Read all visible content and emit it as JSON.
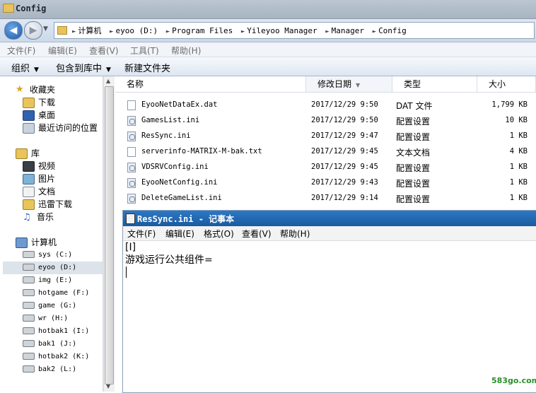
{
  "window": {
    "title": "Config"
  },
  "address": {
    "crumbs": [
      "计算机",
      "eyoo (D:)",
      "Program Files",
      "Yileyoo Manager",
      "Manager",
      "Config"
    ]
  },
  "menubar": [
    "文件(F)",
    "编辑(E)",
    "查看(V)",
    "工具(T)",
    "帮助(H)"
  ],
  "toolbar": {
    "organize": "组织",
    "include": "包含到库中",
    "newfolder": "新建文件夹"
  },
  "nav": {
    "favorites": {
      "label": "收藏夹",
      "items": [
        "下载",
        "桌面",
        "最近访问的位置"
      ]
    },
    "libraries": {
      "label": "库",
      "items": [
        "视频",
        "图片",
        "文档",
        "迅雷下载",
        "音乐"
      ]
    },
    "computer": {
      "label": "计算机",
      "drives": [
        "sys (C:)",
        "eyoo (D:)",
        "img (E:)",
        "hotgame (F:)",
        "game (G:)",
        "wr (H:)",
        "hotbak1 (I:)",
        "bak1 (J:)",
        "hotbak2 (K:)",
        "bak2 (L:)"
      ]
    }
  },
  "columns": {
    "name": "名称",
    "date": "修改日期",
    "type": "类型",
    "size": "大小"
  },
  "files": [
    {
      "name": "EyooNetDataEx.dat",
      "date": "2017/12/29 9:50",
      "type": "DAT 文件",
      "size": "1,799 KB",
      "icon": "dat-file-icon"
    },
    {
      "name": "GamesList.ini",
      "date": "2017/12/29 9:50",
      "type": "配置设置",
      "size": "10 KB",
      "icon": "config-file-icon"
    },
    {
      "name": "ResSync.ini",
      "date": "2017/12/29 9:47",
      "type": "配置设置",
      "size": "1 KB",
      "icon": "config-file-icon"
    },
    {
      "name": "serverinfo-MATRIX-M-bak.txt",
      "date": "2017/12/29 9:45",
      "type": "文本文档",
      "size": "4 KB",
      "icon": "text-file-icon"
    },
    {
      "name": "VDSRVConfig.ini",
      "date": "2017/12/29 9:45",
      "type": "配置设置",
      "size": "1 KB",
      "icon": "config-file-icon"
    },
    {
      "name": "EyooNetConfig.ini",
      "date": "2017/12/29 9:43",
      "type": "配置设置",
      "size": "1 KB",
      "icon": "config-file-icon"
    },
    {
      "name": "DeleteGameList.ini",
      "date": "2017/12/29 9:14",
      "type": "配置设置",
      "size": "1 KB",
      "icon": "config-file-icon"
    }
  ],
  "notepad": {
    "title": "ResSync.ini - 记事本",
    "menu": [
      "文件(F)",
      "编辑(E)",
      "格式(O)",
      "查看(V)",
      "帮助(H)"
    ],
    "lines": [
      "[I]",
      "游戏运行公共组件="
    ]
  },
  "watermark": "583go.com"
}
